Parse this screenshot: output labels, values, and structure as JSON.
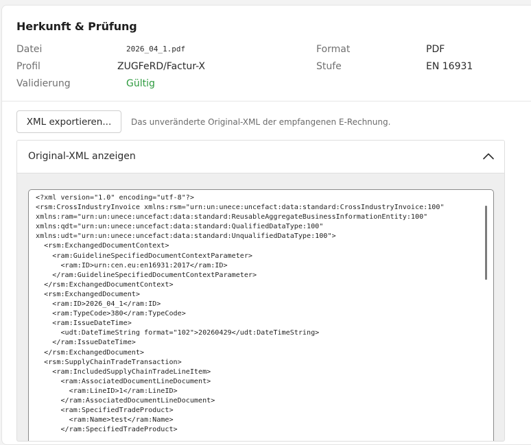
{
  "section": {
    "title": "Herkunft & Prüfung"
  },
  "meta": {
    "file_label": "Datei",
    "file_value": "2026_04_1.pdf",
    "format_label": "Format",
    "format_value": "PDF",
    "profile_label": "Profil",
    "profile_value": "ZUGFeRD/Factur-X",
    "level_label": "Stufe",
    "level_value": "EN 16931",
    "validation_label": "Validierung",
    "validation_value": "Gültig",
    "validation_color": "#2e9a3f"
  },
  "export": {
    "button_label": "XML exportieren...",
    "hint": "Das unveränderte Original-XML der empfangenen E-Rechnung."
  },
  "accordion": {
    "title": "Original-XML anzeigen",
    "expanded": true,
    "icon": "chevron-up-icon"
  },
  "xml": {
    "content": "<?xml version=\"1.0\" encoding=\"utf-8\"?>\n<rsm:CrossIndustryInvoice xmlns:rsm=\"urn:un:unece:uncefact:data:standard:CrossIndustryInvoice:100\"\nxmlns:ram=\"urn:un:unece:uncefact:data:standard:ReusableAggregateBusinessInformationEntity:100\"\nxmlns:qdt=\"urn:un:unece:uncefact:data:standard:QualifiedDataType:100\"\nxmlns:udt=\"urn:un:unece:uncefact:data:standard:UnqualifiedDataType:100\">\n  <rsm:ExchangedDocumentContext>\n    <ram:GuidelineSpecifiedDocumentContextParameter>\n      <ram:ID>urn:cen.eu:en16931:2017</ram:ID>\n    </ram:GuidelineSpecifiedDocumentContextParameter>\n  </rsm:ExchangedDocumentContext>\n  <rsm:ExchangedDocument>\n    <ram:ID>2026_04_1</ram:ID>\n    <ram:TypeCode>380</ram:TypeCode>\n    <ram:IssueDateTime>\n      <udt:DateTimeString format=\"102\">20260429</udt:DateTimeString>\n    </ram:IssueDateTime>\n  </rsm:ExchangedDocument>\n  <rsm:SupplyChainTradeTransaction>\n    <ram:IncludedSupplyChainTradeLineItem>\n      <ram:AssociatedDocumentLineDocument>\n        <ram:LineID>1</ram:LineID>\n      </ram:AssociatedDocumentLineDocument>\n      <ram:SpecifiedTradeProduct>\n        <ram:Name>test</ram:Name>\n      </ram:SpecifiedTradeProduct>"
  }
}
